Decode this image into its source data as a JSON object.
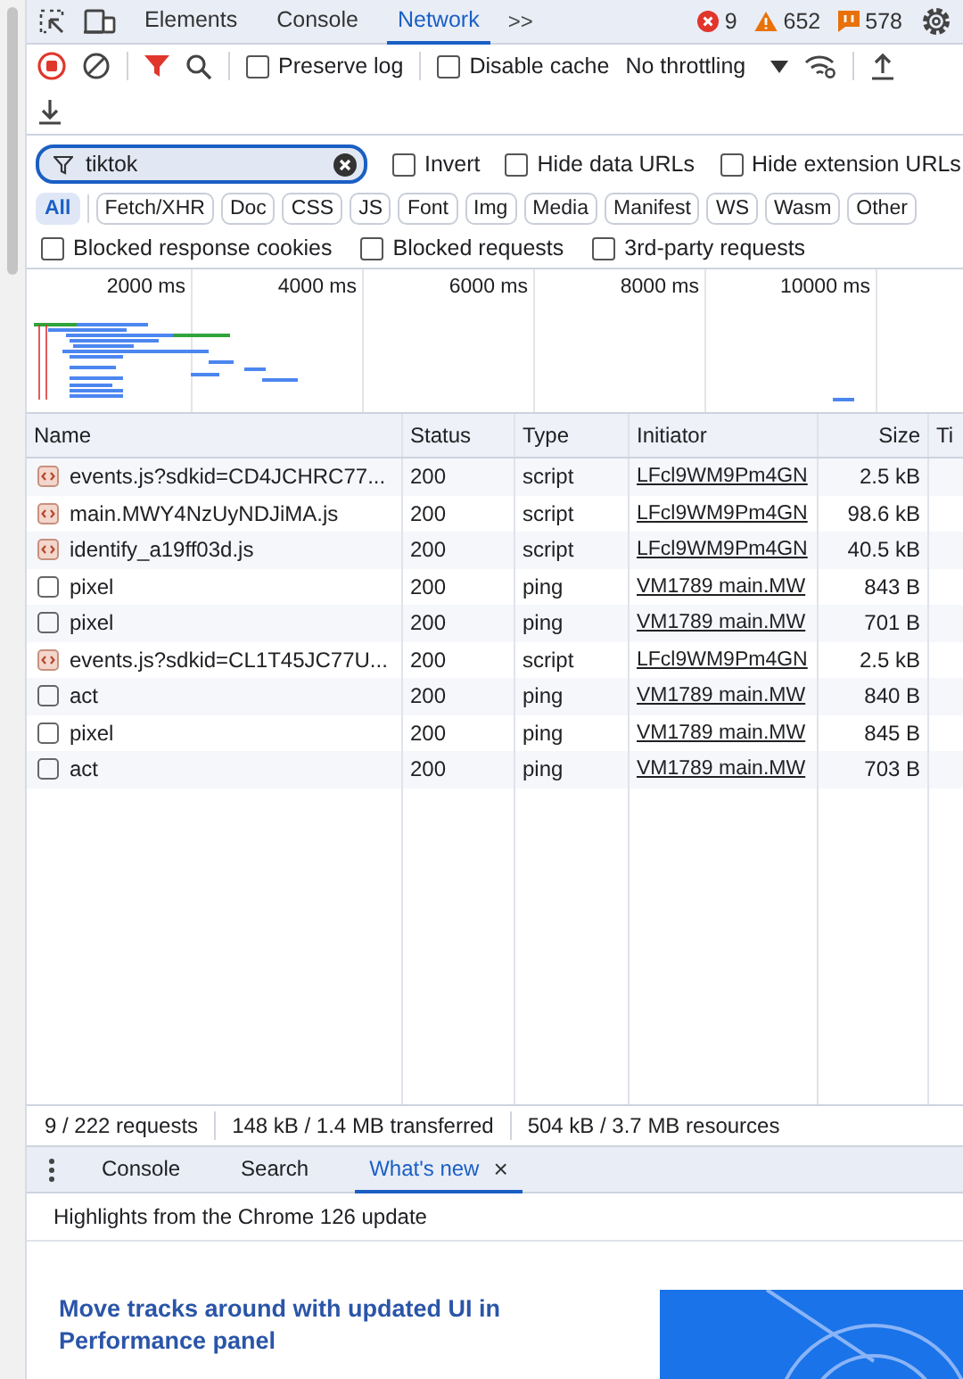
{
  "tabs": [
    {
      "label": "Elements",
      "selected": false
    },
    {
      "label": "Console",
      "selected": false
    },
    {
      "label": "Network",
      "selected": true
    }
  ],
  "more_tabs": ">>",
  "counts": [
    {
      "kind": "error",
      "text": "9"
    },
    {
      "kind": "warning",
      "text": "652"
    },
    {
      "kind": "info",
      "text": "578"
    }
  ],
  "toolbar": {
    "recording": true,
    "checkboxes": [
      {
        "label": "Preserve log",
        "checked": false
      },
      {
        "label": "Disable cache",
        "checked": false
      }
    ],
    "throttling": "No throttling"
  },
  "filter": {
    "value": "tiktok",
    "checkboxes": [
      {
        "label": "Invert",
        "checked": false
      },
      {
        "label": "Hide data URLs",
        "checked": false
      },
      {
        "label": "Hide extension URLs",
        "checked": false
      }
    ]
  },
  "types": [
    {
      "label": "All",
      "selected": true
    },
    {
      "label": "Fetch/XHR",
      "selected": false
    },
    {
      "label": "Doc",
      "selected": false
    },
    {
      "label": "CSS",
      "selected": false
    },
    {
      "label": "JS",
      "selected": false
    },
    {
      "label": "Font",
      "selected": false
    },
    {
      "label": "Img",
      "selected": false
    },
    {
      "label": "Media",
      "selected": false
    },
    {
      "label": "Manifest",
      "selected": false
    },
    {
      "label": "WS",
      "selected": false
    },
    {
      "label": "Wasm",
      "selected": false
    },
    {
      "label": "Other",
      "selected": false
    }
  ],
  "more_filters": [
    {
      "label": "Blocked response cookies",
      "checked": false
    },
    {
      "label": "Blocked requests",
      "checked": false
    },
    {
      "label": "3rd-party requests",
      "checked": false
    }
  ],
  "overview": {
    "ticks": [
      "2000 ms",
      "4000 ms",
      "6000 ms",
      "8000 ms",
      "10000 ms"
    ]
  },
  "table": {
    "columns": [
      "Name",
      "Status",
      "Type",
      "Initiator",
      "Size",
      "Ti"
    ],
    "rows": [
      {
        "kind": "script",
        "name": "events.js?sdkid=CD4JCHRC77...",
        "status": "200",
        "type": "script",
        "initiator": "LFcl9WM9Pm4GN",
        "size": "2.5 kB"
      },
      {
        "kind": "script",
        "name": "main.MWY4NzUyNDJiMA.js",
        "status": "200",
        "type": "script",
        "initiator": "LFcl9WM9Pm4GN",
        "size": "98.6 kB"
      },
      {
        "kind": "script",
        "name": "identify_a19ff03d.js",
        "status": "200",
        "type": "script",
        "initiator": "LFcl9WM9Pm4GN",
        "size": "40.5 kB"
      },
      {
        "kind": "other",
        "name": "pixel",
        "status": "200",
        "type": "ping",
        "initiator": "VM1789 main.MW",
        "size": "843 B"
      },
      {
        "kind": "other",
        "name": "pixel",
        "status": "200",
        "type": "ping",
        "initiator": "VM1789 main.MW",
        "size": "701 B"
      },
      {
        "kind": "script",
        "name": "events.js?sdkid=CL1T45JC77U...",
        "status": "200",
        "type": "script",
        "initiator": "LFcl9WM9Pm4GN",
        "size": "2.5 kB"
      },
      {
        "kind": "other",
        "name": "act",
        "status": "200",
        "type": "ping",
        "initiator": "VM1789 main.MW",
        "size": "840 B"
      },
      {
        "kind": "other",
        "name": "pixel",
        "status": "200",
        "type": "ping",
        "initiator": "VM1789 main.MW",
        "size": "845 B"
      },
      {
        "kind": "other",
        "name": "act",
        "status": "200",
        "type": "ping",
        "initiator": "VM1789 main.MW",
        "size": "703 B"
      }
    ]
  },
  "status_bar": [
    "9 / 222 requests",
    "148 kB / 1.4 MB transferred",
    "504 kB / 3.7 MB resources"
  ],
  "drawer": {
    "tabs": [
      {
        "label": "Console",
        "selected": false,
        "closable": false
      },
      {
        "label": "Search",
        "selected": false,
        "closable": false
      },
      {
        "label": "What's new",
        "selected": true,
        "closable": true
      }
    ],
    "close": "×"
  },
  "whats_new": {
    "subtitle": "Highlights from the Chrome 126 update",
    "headline": "Move tracks around with updated UI in Performance panel"
  }
}
